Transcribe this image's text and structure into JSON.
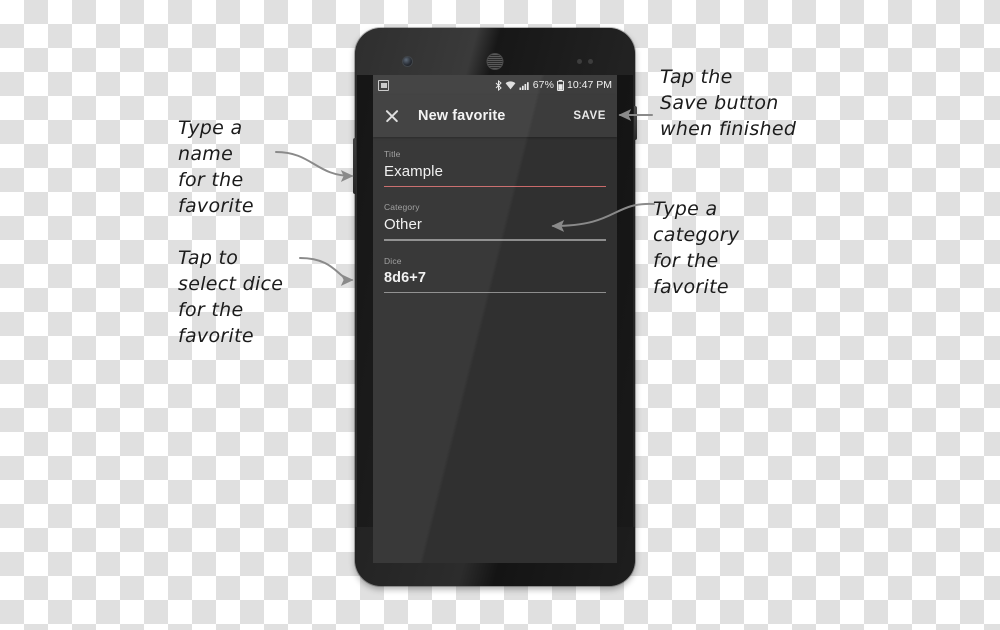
{
  "device": {
    "name": "android-phone",
    "hardware": {
      "front_camera": "front-camera",
      "earpiece": "earpiece-speaker",
      "proximity_sensor": "proximity-sensor",
      "power_button": "power-button",
      "volume_button": "volume-button"
    }
  },
  "status_bar": {
    "notification_icon": "screenshot-icon",
    "bluetooth_icon": "bluetooth-icon",
    "wifi_icon": "wifi-icon",
    "signal_icon": "cellular-signal-icon",
    "battery_percent": "67%",
    "battery_icon": "battery-icon",
    "time": "10:47 PM"
  },
  "app_bar": {
    "close_icon": "close-icon",
    "title": "New favorite",
    "save_label": "SAVE"
  },
  "form": {
    "fields": [
      {
        "label": "Title",
        "value": "Example",
        "focused": true,
        "bold": false
      },
      {
        "label": "Category",
        "value": "Other",
        "focused": false,
        "bold": false
      },
      {
        "label": "Dice",
        "value": "8d6+7",
        "focused": false,
        "bold": true
      }
    ]
  },
  "annotations": {
    "title_note": "Type a\nname\nfor the\nfavorite",
    "dice_note": "Tap to\nselect dice\nfor the\nfavorite",
    "save_note": "Tap the\nSave button\nwhen finished",
    "category_note": "Type a\ncategory\nfor the\nfavorite"
  },
  "colors": {
    "screen_background": "#303030",
    "app_bar": "#3c3c3c",
    "status_bar": "#3d3d3d",
    "accent_underline": "#c96a6a",
    "inactive_underline": "#8d8d8d",
    "annotation_ink": "#1b1b1b",
    "arrow_stroke": "#8a8a8a"
  }
}
